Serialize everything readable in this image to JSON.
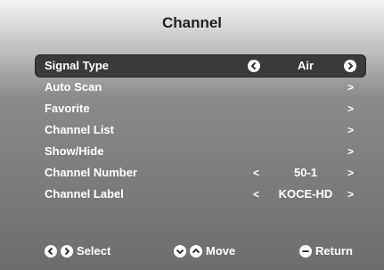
{
  "title": "Channel",
  "menu": [
    {
      "label": "Signal Type",
      "value": "Air",
      "selected": true
    },
    {
      "label": "Auto Scan",
      "value": "",
      "right": ">"
    },
    {
      "label": "Favorite",
      "value": "",
      "right": ">"
    },
    {
      "label": "Channel List",
      "value": "",
      "right": ">"
    },
    {
      "label": "Show/Hide",
      "value": "",
      "right": ">"
    },
    {
      "label": "Channel Number",
      "value": "50-1",
      "left": "<",
      "right": ">"
    },
    {
      "label": "Channel Label",
      "value": "KOCE-HD",
      "left": "<",
      "right": ">"
    }
  ],
  "footer": {
    "select": "Select",
    "move": "Move",
    "return": "Return"
  },
  "icons": {
    "left_right": "left-right-circle-icons",
    "up_down": "down-up-circle-icons",
    "return": "return-circle-icon"
  }
}
